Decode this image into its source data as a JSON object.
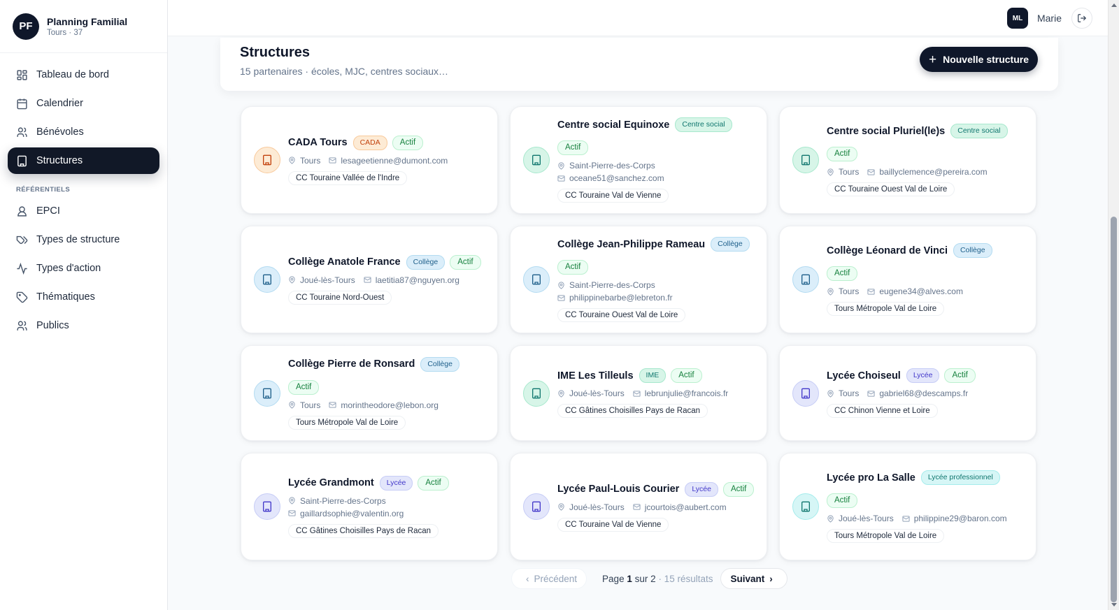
{
  "brand": {
    "logo": "PF",
    "name": "Planning Familial",
    "sub": "Tours · 37"
  },
  "nav": {
    "main": [
      {
        "label": "Tableau de bord",
        "icon": "dashboard-icon"
      },
      {
        "label": "Calendrier",
        "icon": "calendar-icon"
      },
      {
        "label": "Bénévoles",
        "icon": "users-icon"
      },
      {
        "label": "Structures",
        "icon": "building-icon",
        "active": true
      }
    ],
    "section_label": "RÉFÉRENTIELS",
    "refs": [
      {
        "label": "EPCI",
        "icon": "user-badge-icon"
      },
      {
        "label": "Types de structure",
        "icon": "tags-icon"
      },
      {
        "label": "Types d'action",
        "icon": "activity-icon"
      },
      {
        "label": "Thématiques",
        "icon": "tag-icon"
      },
      {
        "label": "Publics",
        "icon": "users-icon"
      }
    ]
  },
  "header": {
    "user_initials": "ML",
    "user_name": "Marie"
  },
  "page": {
    "title": "Structures",
    "subtitle": "15 partenaires · écoles, MJC, centres sociaux…",
    "new_button": "Nouvelle structure"
  },
  "cards": [
    {
      "name": "CADA Tours",
      "type": "CADA",
      "status": "Actif",
      "city": "Tours",
      "email": "lesageetienne@dumont.com",
      "epci": "CC Touraine Vallée de l'Indre"
    },
    {
      "name": "Centre social Equinoxe",
      "type": "Centre social",
      "status": "Actif",
      "city": "Saint-Pierre-des-Corps",
      "email": "oceane51@sanchez.com",
      "epci": "CC Touraine Val de Vienne"
    },
    {
      "name": "Centre social Pluriel(le)s",
      "type": "Centre social",
      "status": "Actif",
      "city": "Tours",
      "email": "baillyclemence@pereira.com",
      "epci": "CC Touraine Ouest Val de Loire"
    },
    {
      "name": "Collège Anatole France",
      "type": "Collège",
      "status": "Actif",
      "city": "Joué-lès-Tours",
      "email": "laetitia87@nguyen.org",
      "epci": "CC Touraine Nord-Ouest"
    },
    {
      "name": "Collège Jean-Philippe Rameau",
      "type": "Collège",
      "status": "Actif",
      "city": "Saint-Pierre-des-Corps",
      "email": "philippinebarbe@lebreton.fr",
      "epci": "CC Touraine Ouest Val de Loire"
    },
    {
      "name": "Collège Léonard de Vinci",
      "type": "Collège",
      "status": "Actif",
      "city": "Tours",
      "email": "eugene34@alves.com",
      "epci": "Tours Métropole Val de Loire"
    },
    {
      "name": "Collège Pierre de Ronsard",
      "type": "Collège",
      "status": "Actif",
      "city": "Tours",
      "email": "morintheodore@lebon.org",
      "epci": "Tours Métropole Val de Loire"
    },
    {
      "name": "IME Les Tilleuls",
      "type": "IME",
      "status": "Actif",
      "city": "Joué-lès-Tours",
      "email": "lebrunjulie@francois.fr",
      "epci": "CC Gâtines Choisilles Pays de Racan"
    },
    {
      "name": "Lycée Choiseul",
      "type": "Lycée",
      "status": "Actif",
      "city": "Tours",
      "email": "gabriel68@descamps.fr",
      "epci": "CC Chinon Vienne et Loire"
    },
    {
      "name": "Lycée Grandmont",
      "type": "Lycée",
      "status": "Actif",
      "city": "Saint-Pierre-des-Corps",
      "email": "gaillardsophie@valentin.org",
      "epci": "CC Gâtines Choisilles Pays de Racan"
    },
    {
      "name": "Lycée Paul-Louis Courier",
      "type": "Lycée",
      "status": "Actif",
      "city": "Joué-lès-Tours",
      "email": "jcourtois@aubert.com",
      "epci": "CC Touraine Val de Vienne"
    },
    {
      "name": "Lycée pro La Salle",
      "type": "Lycée professionnel",
      "status": "Actif",
      "city": "Joué-lès-Tours",
      "email": "philippine29@baron.com",
      "epci": "Tours Métropole Val de Loire"
    }
  ],
  "pagination": {
    "prev": "Précédent",
    "page_label": "Page",
    "current": "1",
    "of_label": "sur",
    "total": "2",
    "results": "· 15 résultats",
    "next": "Suivant"
  },
  "colors": {
    "primary": "#0f172a",
    "active_green": "#15803d"
  }
}
